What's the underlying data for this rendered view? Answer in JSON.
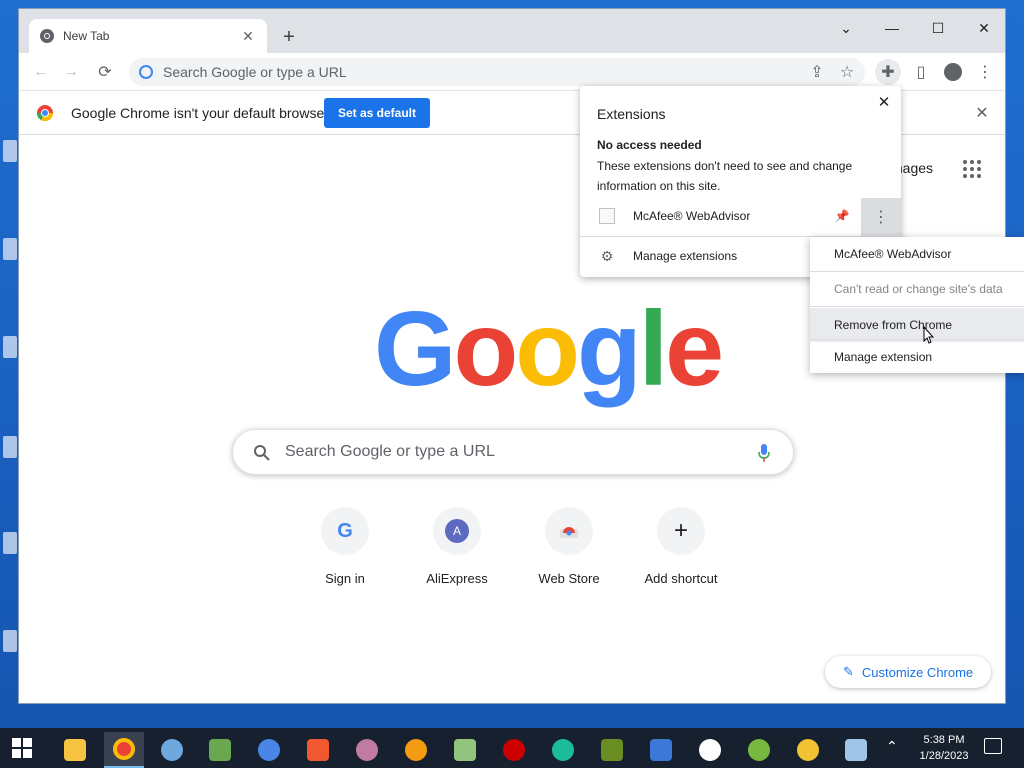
{
  "window": {
    "tab_title": "New Tab",
    "omnibox_placeholder": "Search Google or type a URL"
  },
  "infobar": {
    "message": "Google Chrome isn't your default browser",
    "button_label": "Set as default"
  },
  "page": {
    "images_link": "mages",
    "logo_text": "Google",
    "search_placeholder": "Search Google or type a URL",
    "shortcuts": [
      {
        "label": "Sign in",
        "letter": "G"
      },
      {
        "label": "AliExpress",
        "letter": "A"
      },
      {
        "label": "Web Store",
        "letter": ""
      },
      {
        "label": "Add shortcut",
        "letter": "+"
      }
    ],
    "customize_label": "Customize Chrome"
  },
  "extensions_popup": {
    "title": "Extensions",
    "section_heading": "No access needed",
    "section_description": "These extensions don't need to see and change information on this site.",
    "extension_name": "McAfee® WebAdvisor",
    "manage_label": "Manage extensions"
  },
  "context_menu": {
    "items": [
      {
        "label": "McAfee® WebAdvisor",
        "disabled": false
      },
      {
        "label": "Can't read or change site's data",
        "disabled": true
      },
      {
        "label": "Remove from Chrome",
        "disabled": false,
        "hovered": true
      },
      {
        "label": "Manage extension",
        "disabled": false
      }
    ]
  },
  "taskbar": {
    "time": "5:38 PM",
    "date": "1/28/2023",
    "apps": [
      "file-explorer",
      "chrome",
      "safari-like",
      "app-green",
      "chromium",
      "brave",
      "photo-app",
      "orange-app",
      "android-app",
      "opera-gx",
      "edge",
      "minecraft",
      "app-store-a",
      "yandex",
      "utorrent",
      "chrome-beta",
      "vpn-a"
    ]
  },
  "colors": {
    "accent": "#1a73e8",
    "google_blue": "#4285F4",
    "google_red": "#EA4335",
    "google_yellow": "#FBBC05",
    "google_green": "#34A853"
  }
}
